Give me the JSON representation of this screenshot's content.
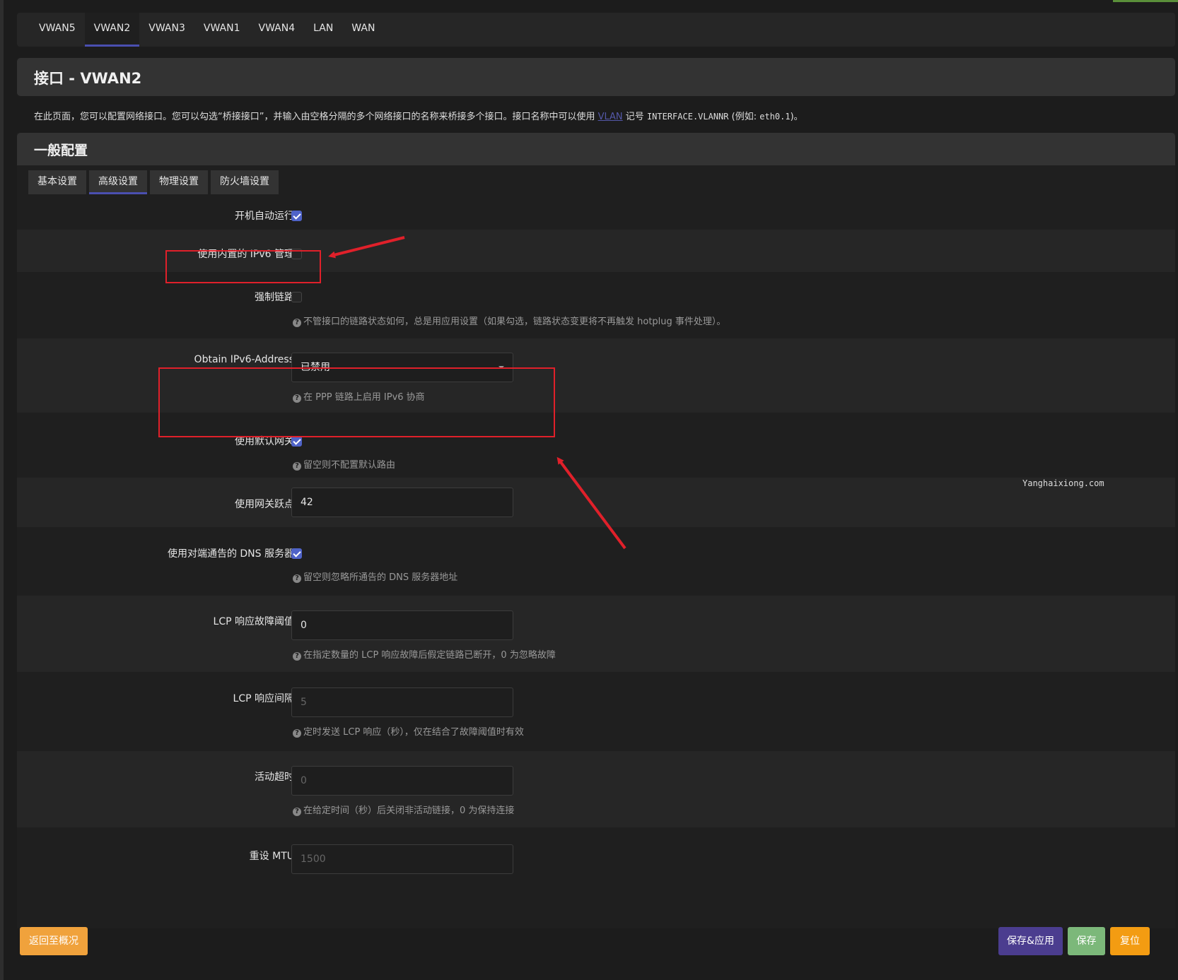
{
  "interface_tabs": [
    "VWAN5",
    "VWAN2",
    "VWAN3",
    "VWAN1",
    "VWAN4",
    "LAN",
    "WAN"
  ],
  "page_title": "接口 - VWAN2",
  "description": {
    "before_link": "在此页面，您可以配置网络接口。您可以勾选“桥接接口”，并输入由空格分隔的多个网络接口的名称来桥接多个接口。接口名称中可以使用 ",
    "link": "VLAN",
    "middle": " 记号 ",
    "code1": "INTERFACE.VLANNR",
    "example": " (例如: ",
    "code2": "eth0.1",
    "end": ")。"
  },
  "section_title": "一般配置",
  "subtabs": [
    "基本设置",
    "高级设置",
    "物理设置",
    "防火墙设置"
  ],
  "fields": {
    "autostart": {
      "label": "开机自动运行",
      "checked": true
    },
    "builtin_ipv6": {
      "label": "使用内置的 IPv6 管理",
      "checked": false
    },
    "force_link": {
      "label": "强制链路",
      "checked": false,
      "help": "不管接口的链路状态如何，总是用应用设置（如果勾选，链路状态变更将不再触发 hotplug 事件处理）。"
    },
    "obtain_ipv6": {
      "label": "Obtain IPv6-Address",
      "value": "已禁用",
      "help": "在 PPP 链路上启用 IPv6 协商"
    },
    "default_gw": {
      "label": "使用默认网关",
      "checked": true,
      "help": "留空则不配置默认路由"
    },
    "gw_metric": {
      "label": "使用网关跃点",
      "value": "42"
    },
    "peer_dns": {
      "label": "使用对端通告的 DNS 服务器",
      "checked": true,
      "help": "留空则忽略所通告的 DNS 服务器地址"
    },
    "lcp_threshold": {
      "label": "LCP 响应故障阈值",
      "value": "0",
      "help": "在指定数量的 LCP 响应故障后假定链路已断开，0 为忽略故障"
    },
    "lcp_interval": {
      "label": "LCP 响应间隔",
      "placeholder": "5",
      "help": "定时发送 LCP 响应（秒），仅在结合了故障阈值时有效"
    },
    "idle_timeout": {
      "label": "活动超时",
      "placeholder": "0",
      "help": "在给定时间（秒）后关闭非活动链接，0 为保持连接"
    },
    "mtu": {
      "label": "重设 MTU",
      "placeholder": "1500"
    }
  },
  "help_icon": "?",
  "watermark": "Yanghaixiong.com",
  "buttons": {
    "back": "返回至概况",
    "save_apply": "保存&应用",
    "save": "保存",
    "reset": "复位"
  },
  "colors": {
    "accent": "#4a4fb0",
    "annotation": "#e0202a",
    "back_button": "#f0a23c",
    "save_apply_button": "#4b3d8f",
    "save_button": "#7cb87a",
    "reset_button": "#f39c12"
  }
}
